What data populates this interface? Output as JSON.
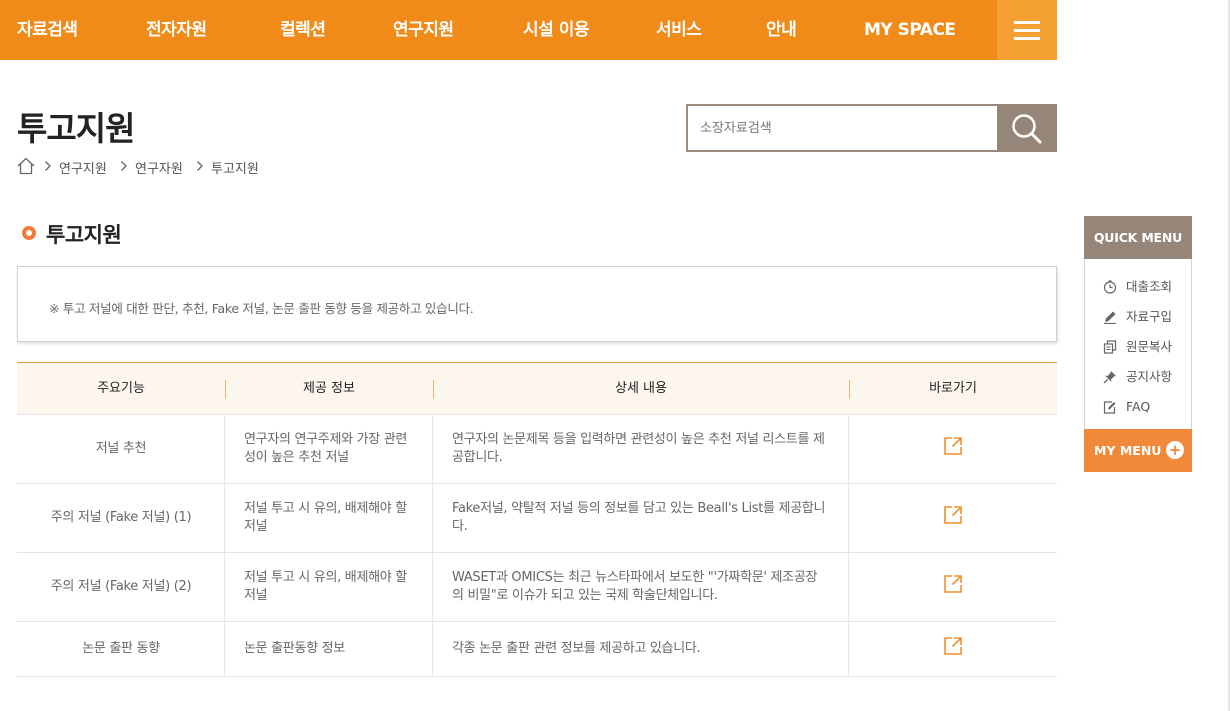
{
  "nav": {
    "items": [
      {
        "label": "자료검색"
      },
      {
        "label": "전자자원"
      },
      {
        "label": "컬렉션"
      },
      {
        "label": "연구지원"
      },
      {
        "label": "시설 이용"
      },
      {
        "label": "서비스"
      },
      {
        "label": "안내"
      },
      {
        "label": "MY SPACE"
      }
    ],
    "menu_icon": "hamburger-icon"
  },
  "page": {
    "title": "투고지원",
    "breadcrumb": [
      "연구지원",
      "연구자원",
      "투고지원"
    ],
    "home_icon": "home-icon"
  },
  "search": {
    "placeholder": "소장자료검색",
    "value": "",
    "icon": "search-icon"
  },
  "section": {
    "title": "투고지원",
    "notice": "※ 투고 저널에 대한 판단, 추천, Fake 저널, 논문 출판 동향 등을 제공하고 있습니다."
  },
  "table": {
    "headers": [
      "주요기능",
      "제공 정보",
      "상세 내용",
      "바로가기"
    ],
    "rows": [
      {
        "feature": "저널 추천",
        "info": "연구자의 연구주제와 가장 관련성이 높은 추천 저널",
        "detail": "연구자의 논문제목 등을 입력하면 관련성이 높은 추천 저널 리스트를 제공합니다."
      },
      {
        "feature": "주의 저널 (Fake 저널) (1)",
        "info": "저널 투고 시 유의, 배제해야 할 저널",
        "detail": "Fake저널, 약탈적 저널 등의 정보를 담고 있는 Beall's List를 제공합니다."
      },
      {
        "feature": "주의 저널 (Fake 저널) (2)",
        "info": "저널 투고 시 유의, 배제해야 할 저널",
        "detail": "WASET과 OMICS는 최근 뉴스타파에서 보도한 \"'가짜학문' 제조공장의 비밀\"로 이슈가 되고 있는 국제 학술단체입니다."
      },
      {
        "feature": "논문 출판 동향",
        "info": "논문 출판동향 정보",
        "detail": "각종 논문 출판 관련 정보를 제공하고 있습니다."
      }
    ],
    "link_icon": "external-link-icon"
  },
  "quick_menu": {
    "title": "QUICK MENU",
    "items": [
      {
        "label": "대출조회",
        "icon": "clock-icon"
      },
      {
        "label": "자료구입",
        "icon": "pencil-icon"
      },
      {
        "label": "원문복사",
        "icon": "copy-icon"
      },
      {
        "label": "공지사항",
        "icon": "pin-icon"
      },
      {
        "label": "FAQ",
        "icon": "edit-icon"
      }
    ],
    "my_menu": "MY MENU",
    "my_menu_icon": "plus-icon"
  },
  "colors": {
    "nav_bg": "#f08a18",
    "accent": "#f08a3a",
    "quick_head": "#958679"
  }
}
